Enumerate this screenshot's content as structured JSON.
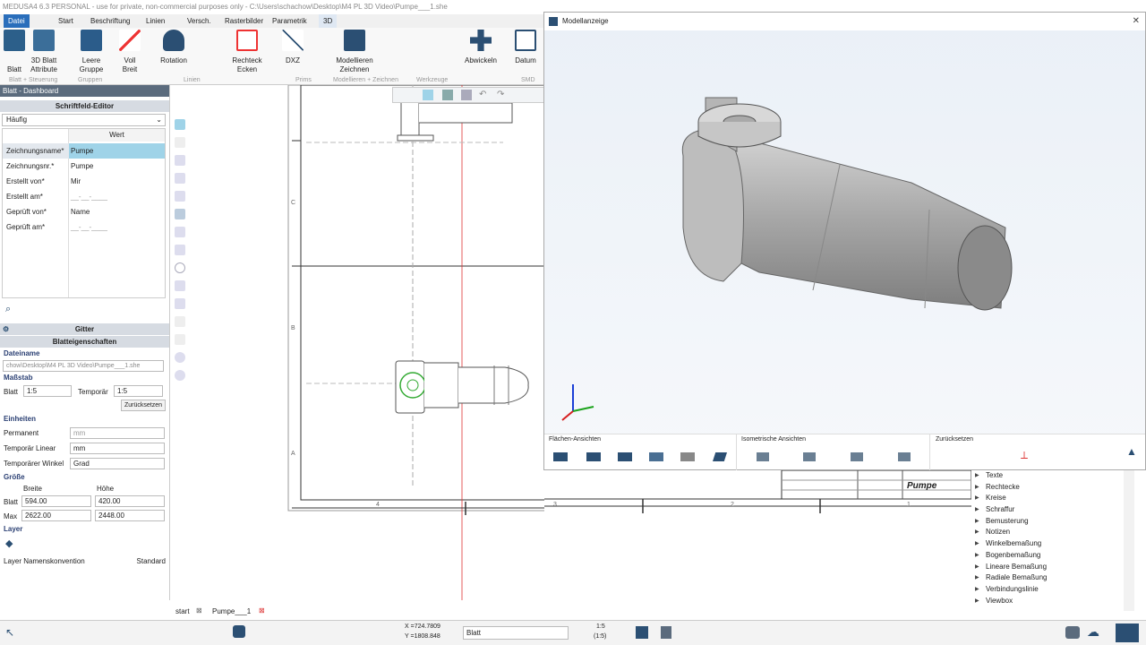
{
  "title": "MEDUSA4 6.3 PERSONAL - use for private, non-commercial purposes only - C:\\Users\\schachow\\Desktop\\M4 PL 3D Video\\Pumpe___1.she",
  "menu_tabs": [
    "Datei",
    "Start",
    "Beschriftung",
    "Linien",
    "Versch.",
    "Rasterbilder",
    "Parametrik",
    "3D"
  ],
  "ribbon": {
    "buttons": [
      "Blatt",
      "3D Blatt Attribute",
      "Leere Gruppe",
      "Voll Breit",
      "Rotation",
      "Rechteck Ecken",
      "DXZ",
      "Modellieren Zeichnen",
      "Abwickeln",
      "Datum"
    ],
    "groups": [
      "Blatt + Steuerung",
      "Gruppen",
      "Linien",
      "Prims",
      "Modellieren + Zeichnen",
      "Werkzeuge",
      "SMD"
    ]
  },
  "left": {
    "dashboard_title": "Blatt - Dashboard",
    "schriftfeld_title": "Schriftfeld-Editor",
    "filter": "Häufig",
    "col_wert": "Wert",
    "fields": [
      {
        "label": "Zeichnungsname*",
        "value": "Pumpe"
      },
      {
        "label": "Zeichnungsnr.*",
        "value": "Pumpe"
      },
      {
        "label": "Erstellt von*",
        "value": "Mir"
      },
      {
        "label": "Erstellt am*",
        "value": "__-__-____"
      },
      {
        "label": "Geprüft von*",
        "value": "Name"
      },
      {
        "label": "Geprüft am*",
        "value": "__-__-____"
      }
    ],
    "gitter": "Gitter",
    "blatteigenschaften": "Blatteigenschaften",
    "dateiname_label": "Dateiname",
    "dateiname": "chow\\Desktop\\M4 PL 3D Video\\Pumpe___1.she",
    "massstab_label": "Maßstab",
    "blatt_label": "Blatt",
    "blatt_scale": "1:5",
    "temporaer_label": "Temporär",
    "temporaer_scale": "1:5",
    "zuruecksetzen": "Zurücksetzen",
    "einheiten_label": "Einheiten",
    "permanent_label": "Permanent",
    "permanent_value": "mm",
    "temp_linear_label": "Temporär Linear",
    "temp_linear_value": "mm",
    "temp_winkel_label": "Temporärer Winkel",
    "temp_winkel_value": "Grad",
    "groesse_label": "Größe",
    "breite_label": "Breite",
    "hoehe_label": "Höhe",
    "blatt_size_label": "Blatt",
    "blatt_breite": "594.00",
    "blatt_hoehe": "420.00",
    "max_label": "Max",
    "max_breite": "2622.00",
    "max_hoehe": "2448.00",
    "layer_label": "Layer",
    "layer_konv_label": "Layer Namenskonvention",
    "layer_konv_value": "Standard"
  },
  "model_window": {
    "title": "Modellanzeige",
    "flaechen_label": "Flächen-Ansichten",
    "iso_label": "Isometrische Ansichten",
    "reset_label": "Zurücksetzen"
  },
  "drawing": {
    "row_labels": [
      "C",
      "B",
      "A"
    ],
    "col_labels": [
      "4",
      "3",
      "2",
      "1"
    ],
    "titleblock_name": "Pumpe"
  },
  "right_list": [
    "Texte",
    "Rechtecke",
    "Kreise",
    "Schraffur",
    "Bemusterung",
    "Notizen",
    "Winkelbemaßung",
    "Bogenbemaßung",
    "Lineare Bemaßung",
    "Radiale Bemaßung",
    "Verbindungslinie",
    "Viewbox"
  ],
  "doc_tabs": [
    "start",
    "Pumpe___1"
  ],
  "status": {
    "x": "X =724.7809",
    "y": "Y =1808.848",
    "layer": "Blatt",
    "scale1": "1:5",
    "scale2": "(1:5)"
  }
}
